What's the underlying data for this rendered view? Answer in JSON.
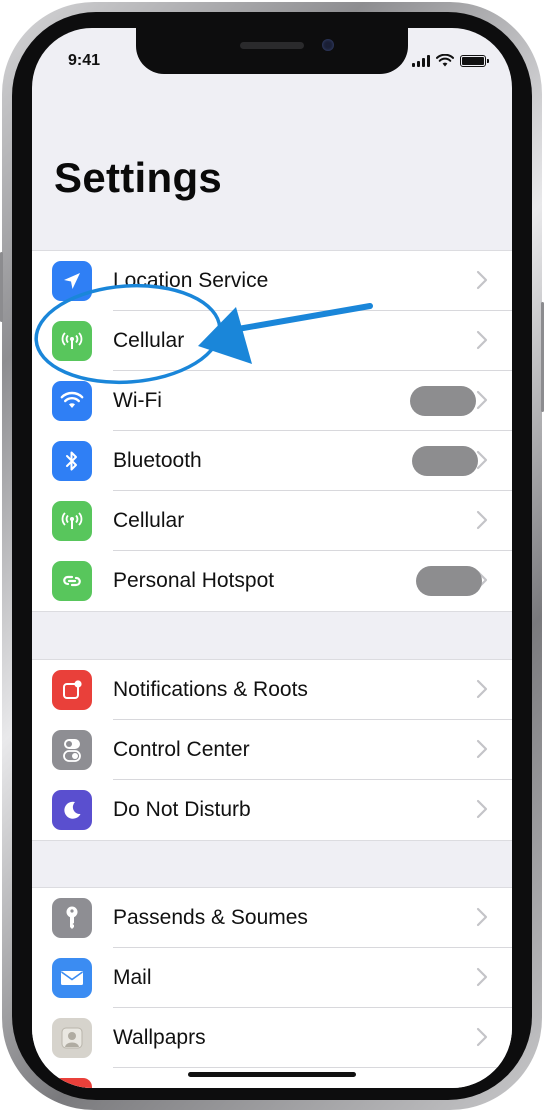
{
  "status_bar": {
    "time": "9:41"
  },
  "page_title": "Settings",
  "group1": [
    {
      "label": "Location Service",
      "icon": "location-arrow-icon",
      "color": "#2f7ff5"
    },
    {
      "label": "Cellular",
      "icon": "antenna-icon",
      "color": "#58c65c"
    },
    {
      "label": "Wi-Fi",
      "icon": "wifi-icon",
      "color": "#2f7ff5"
    },
    {
      "label": "Bluetooth",
      "icon": "bluetooth-icon",
      "color": "#2f7ff5"
    },
    {
      "label": "Cellular",
      "icon": "antenna-icon",
      "color": "#58c65c"
    },
    {
      "label": "Personal Hotspot",
      "icon": "hotspot-icon",
      "color": "#58c65c"
    }
  ],
  "group2": [
    {
      "label": "Notifications & Roots",
      "icon": "notifications-icon",
      "color": "#e9403a"
    },
    {
      "label": "Control Center",
      "icon": "control-center-icon",
      "color": "#8e8e93"
    },
    {
      "label": "Do Not Disturb",
      "icon": "moon-icon",
      "color": "#5a4fcf"
    }
  ],
  "group3": [
    {
      "label": "Passends & Soumes",
      "icon": "key-icon",
      "color": "#8e8e93"
    },
    {
      "label": "Mail",
      "icon": "mail-icon",
      "color": "#3b8cf2"
    },
    {
      "label": "Wallpaprs",
      "icon": "wallpaper-icon",
      "color": "#d6d3cc"
    }
  ],
  "annotation": {
    "color": "#1a86d9"
  }
}
